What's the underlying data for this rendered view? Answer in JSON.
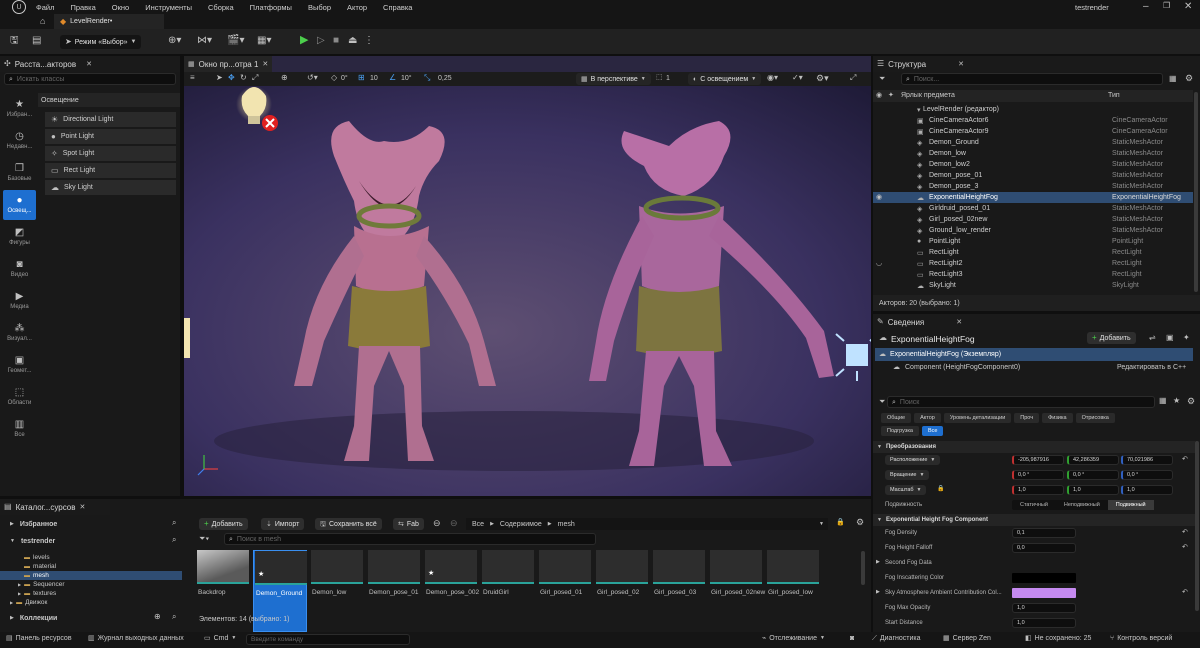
{
  "menu": {
    "items": [
      "Файл",
      "Правка",
      "Окно",
      "Инструменты",
      "Сборка",
      "Платформы",
      "Выбор",
      "Актор",
      "Справка"
    ],
    "project_name": "testrender"
  },
  "tabs": {
    "level_tab": "LevelRender•"
  },
  "toolbar": {
    "mode_label": "Режим «Выбор»"
  },
  "place_actors": {
    "tab_title": "Расста...акторов",
    "search_placeholder": "Искать классы",
    "section_header": "Освещение",
    "categories": [
      "Избран...",
      "Недавн...",
      "Базовые",
      "Освещ...",
      "Фигуры",
      "Видео",
      "Медиа",
      "Визуал...",
      "Геомет...",
      "Области",
      "Все"
    ],
    "items": [
      "Directional Light",
      "Point Light",
      "Spot Light",
      "Rect Light",
      "Sky Light"
    ]
  },
  "viewport": {
    "tab_title": "Окно пр...отра 1",
    "perspective_label": "В перспективе",
    "lighting_label": "С освещением",
    "rotation_value": "0°",
    "grid_value": "10",
    "angle_value": "10°",
    "scale_value": "0,25",
    "camera_speed": "1"
  },
  "outliner": {
    "tab_title": "Структура",
    "search_placeholder": "Поиск...",
    "col_label": "Ярлык предмета",
    "col_type": "Тип",
    "root": "LevelRender (редактор)",
    "rows": [
      {
        "name": "CineCameraActor6",
        "type": "CineCameraActor"
      },
      {
        "name": "CineCameraActor9",
        "type": "CineCameraActor"
      },
      {
        "name": "Demon_Ground",
        "type": "StaticMeshActor"
      },
      {
        "name": "Demon_low",
        "type": "StaticMeshActor"
      },
      {
        "name": "Demon_low2",
        "type": "StaticMeshActor"
      },
      {
        "name": "Demon_pose_01",
        "type": "StaticMeshActor"
      },
      {
        "name": "Demon_pose_3",
        "type": "StaticMeshActor"
      },
      {
        "name": "ExponentialHeightFog",
        "type": "ExponentialHeightFog"
      },
      {
        "name": "Girldruid_posed_01",
        "type": "StaticMeshActor"
      },
      {
        "name": "Girl_posed_02new",
        "type": "StaticMeshActor"
      },
      {
        "name": "Ground_low_render",
        "type": "StaticMeshActor"
      },
      {
        "name": "PointLight",
        "type": "PointLight"
      },
      {
        "name": "RectLight",
        "type": "RectLight"
      },
      {
        "name": "RectLight2",
        "type": "RectLight"
      },
      {
        "name": "RectLight3",
        "type": "RectLight"
      },
      {
        "name": "SkyLight",
        "type": "SkyLight"
      }
    ],
    "footer": "Акторов: 20 (выбрано: 1)"
  },
  "details": {
    "tab_title": "Сведения",
    "actor_name": "ExponentialHeightFog",
    "add_label": "Добавить",
    "instance_label": "ExponentialHeightFog (Экземпляр)",
    "component_label": "Component (HeightFogComponent0)",
    "edit_cpp": "Редактировать в C++",
    "search_placeholder": "Поиск",
    "filter_tabs": [
      "Общие",
      "Актор",
      "Уровень детализации",
      "Проч",
      "Физика",
      "Отрисовка",
      "Подгрузка",
      "Все"
    ],
    "transform_header": "Преобразования",
    "location_label": "Расположение",
    "location": [
      "-205,987916",
      "42,286359",
      "70,021986"
    ],
    "rotation_label": "Вращение",
    "rotation": [
      "0,0 °",
      "0,0 °",
      "0,0 °"
    ],
    "scale_label": "Масштаб",
    "scale": [
      "1,0",
      "1,0",
      "1,0"
    ],
    "mobility_label": "Подвижность",
    "mobility_options": [
      "Статичный",
      "Неподвижный",
      "Подвижный"
    ],
    "fog_header": "Exponential Height Fog Component",
    "fog_density_label": "Fog Density",
    "fog_density": "0,1",
    "fog_falloff_label": "Fog Height Falloff",
    "fog_falloff": "0,0",
    "second_fog": "Second Fog Data",
    "inscatter_label": "Fog Inscattering Color",
    "sky_atmo_label": "Sky Atmosphere Ambient Contribution Col...",
    "max_opacity_label": "Fog Max Opacity",
    "max_opacity": "1,0",
    "start_distance_label": "Start Distance",
    "start_distance": "1,0",
    "colors": {
      "inscatter": "#000000",
      "sky_atmo": "#c58af0"
    }
  },
  "content_browser": {
    "tab_title": "Каталог...сурсов",
    "favorites": "Избранное",
    "project": "testrender",
    "folders": [
      "levels",
      "material",
      "mesh",
      "Sequencer",
      "textures"
    ],
    "engine": "Движок",
    "collections": "Коллекции",
    "add_label": "Добавить",
    "import_label": "Импорт",
    "save_all_label": "Сохранить всё",
    "fab_label": "Fab",
    "path": [
      "Все",
      "Содержимое",
      "mesh"
    ],
    "search_placeholder": "Поиск в mesh",
    "assets": [
      "Backdrop",
      "Demon_Ground",
      "Demon_low",
      "Demon_pose_01",
      "Demon_pose_002",
      "DruidGirl",
      "Girl_posed_01",
      "Girl_posed_02",
      "Girl_posed_03",
      "Girl_posed_02new",
      "Girl_posed_low"
    ],
    "status": "Элементов: 14 (выбрано: 1)"
  },
  "statusbar": {
    "resources": "Панель ресурсов",
    "output_log": "Журнал выходных данных",
    "cmd": "Cmd",
    "cmd_placeholder": "Введите команду",
    "tracking": "Отслеживание",
    "diagnostics": "Диагностика",
    "zen": "Сервер Zen",
    "unsaved": "Не сохранено: 25",
    "version_control": "Контроль версий"
  }
}
